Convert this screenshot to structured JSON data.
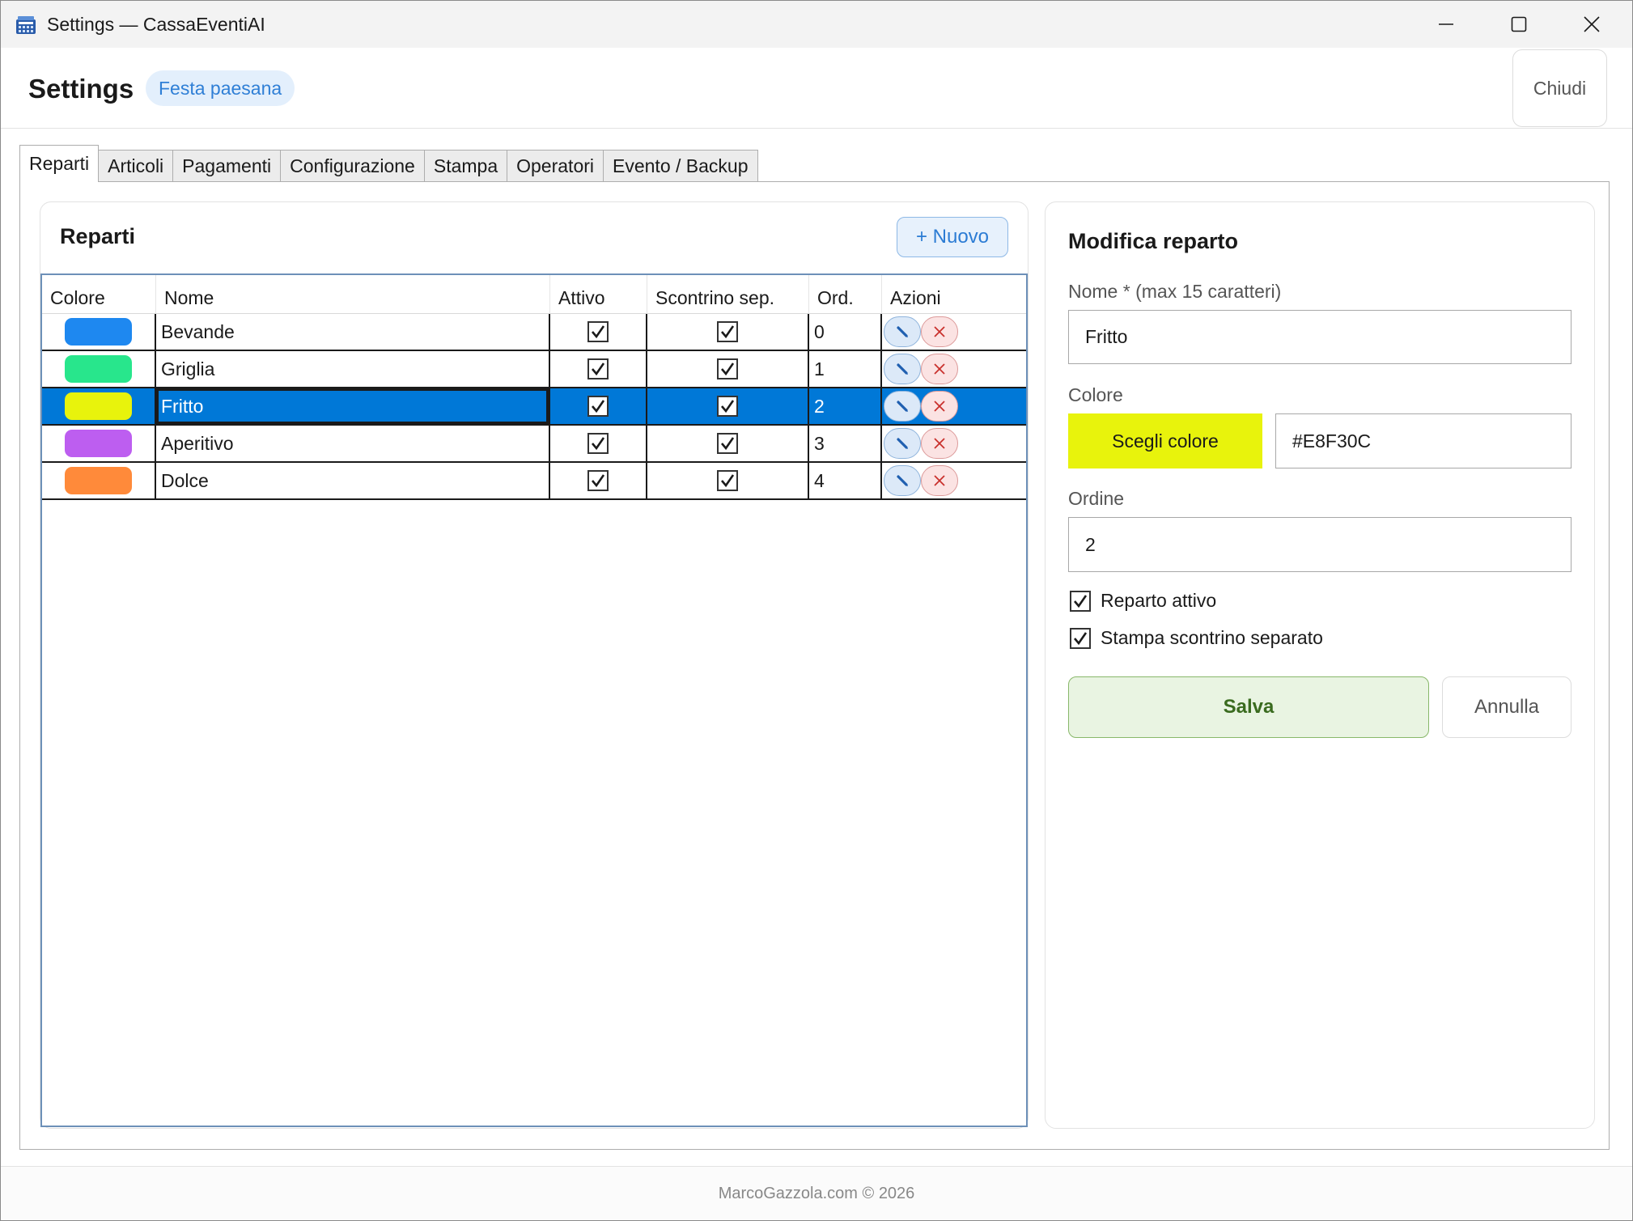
{
  "window": {
    "title": "Settings — CassaEventiAI"
  },
  "header": {
    "title": "Settings",
    "event_badge": "Festa paesana",
    "close_label": "Chiudi"
  },
  "tabs": [
    {
      "label": "Reparti",
      "active": true
    },
    {
      "label": "Articoli"
    },
    {
      "label": "Pagamenti"
    },
    {
      "label": "Configurazione"
    },
    {
      "label": "Stampa"
    },
    {
      "label": "Operatori"
    },
    {
      "label": "Evento / Backup"
    }
  ],
  "list": {
    "title": "Reparti",
    "new_label": "+ Nuovo",
    "columns": [
      "Colore",
      "Nome",
      "Attivo",
      "Scontrino sep.",
      "Ord.",
      "Azioni"
    ],
    "rows": [
      {
        "color": "#1e88f0",
        "name": "Bevande",
        "active": true,
        "separate": true,
        "order": "0"
      },
      {
        "color": "#28e68c",
        "name": "Griglia",
        "active": true,
        "separate": true,
        "order": "1"
      },
      {
        "color": "#e8f30c",
        "name": "Fritto",
        "active": true,
        "separate": true,
        "order": "2",
        "selected": true
      },
      {
        "color": "#bd5ef0",
        "name": "Aperitivo",
        "active": true,
        "separate": true,
        "order": "3"
      },
      {
        "color": "#ff8a3a",
        "name": "Dolce",
        "active": true,
        "separate": true,
        "order": "4"
      }
    ]
  },
  "editor": {
    "title": "Modifica reparto",
    "name_label": "Nome * (max 15 caratteri)",
    "name_value": "Fritto",
    "color_label": "Colore",
    "color_button": "Scegli colore",
    "color_value": "#E8F30C",
    "order_label": "Ordine",
    "order_value": "2",
    "active_label": "Reparto attivo",
    "active_checked": true,
    "separate_label": "Stampa scontrino separato",
    "separate_checked": true,
    "save_label": "Salva",
    "cancel_label": "Annulla"
  },
  "footer": {
    "text": "MarcoGazzola.com © 2026"
  },
  "colors": {
    "accent": "#0078d7",
    "selected_color": "#E8F30C"
  }
}
